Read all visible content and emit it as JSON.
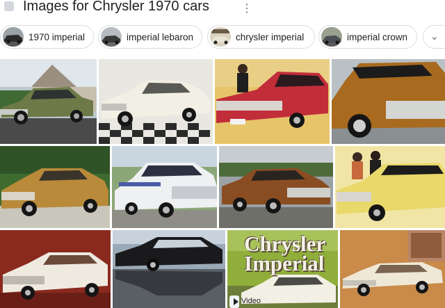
{
  "header": {
    "title": "Images for Chrysler 1970 cars",
    "more_icon": "more-vert-icon"
  },
  "chips": [
    {
      "label": "1970 imperial"
    },
    {
      "label": "imperial lebaron"
    },
    {
      "label": "chrysler imperial"
    },
    {
      "label": "imperial crown"
    }
  ],
  "chip_next_icon": "chevron-down-icon",
  "tiles": {
    "imperial_poster_text_line1": "Chrysler",
    "imperial_poster_text_line2": "Imperial",
    "video_label": "Video"
  },
  "colors": {
    "chip_border": "#dadce0",
    "text": "#202124",
    "icon": "#5f6368"
  }
}
